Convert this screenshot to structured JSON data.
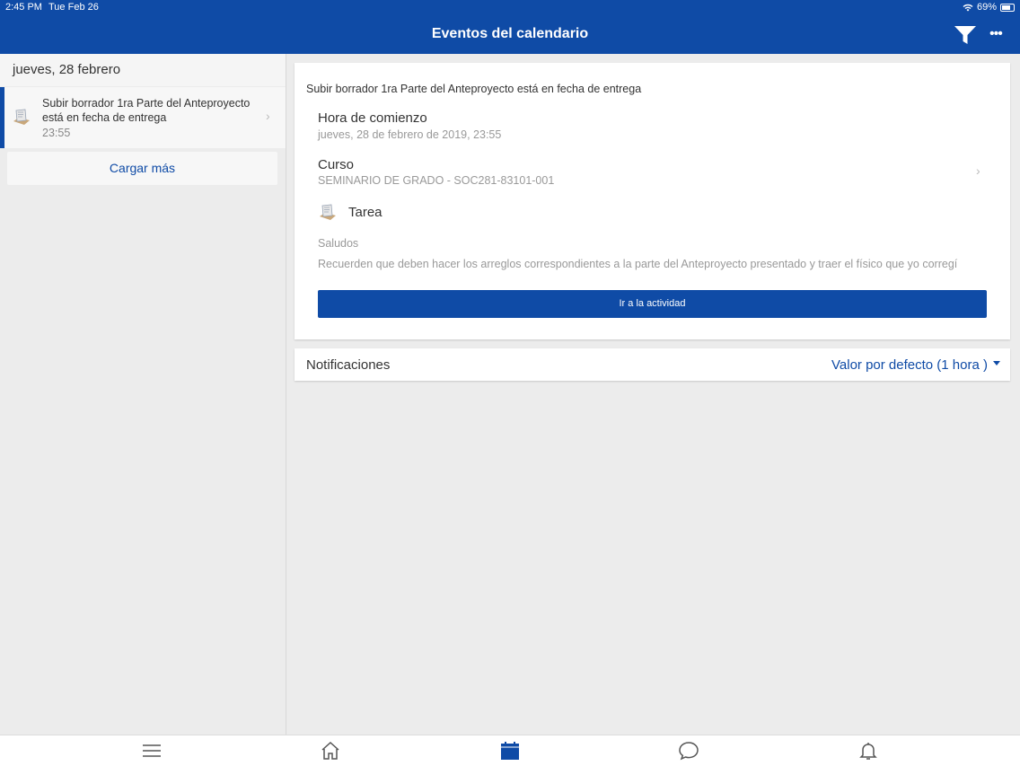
{
  "status": {
    "time": "2:45 PM",
    "date": "Tue Feb 26",
    "battery": "69%"
  },
  "header": {
    "title": "Eventos del calendario",
    "filter_icon": "filter-icon",
    "more_label": "•••"
  },
  "colors": {
    "brand": "#0f4ba6",
    "background": "#ececec"
  },
  "left": {
    "day_header": "jueves, 28 febrero",
    "event": {
      "title": "Subir borrador 1ra Parte del Anteproyecto está en fecha de entrega",
      "time": "23:55",
      "icon": "assignment-icon"
    },
    "load_more": "Cargar más"
  },
  "detail": {
    "title": "Subir borrador 1ra Parte del Anteproyecto está en fecha de entrega",
    "start_label": "Hora de comienzo",
    "start_value": "jueves, 28 de febrero de 2019, 23:55",
    "course_label": "Curso",
    "course_value": "SEMINARIO DE GRADO - SOC281-83101-001",
    "task_label": "Tarea",
    "desc_line1": "Saludos",
    "desc_line2": "Recuerden que deben hacer los arreglos correspondientes a la parte del Anteproyecto presentado y traer el físico que yo corregí",
    "button": "Ir a la actividad"
  },
  "notifications": {
    "label": "Notificaciones",
    "value": "Valor por defecto (1 hora )"
  },
  "tabs": [
    {
      "name": "menu-icon",
      "active": false
    },
    {
      "name": "home-icon",
      "active": false
    },
    {
      "name": "calendar-icon",
      "active": true
    },
    {
      "name": "messages-icon",
      "active": false
    },
    {
      "name": "notifications-icon",
      "active": false
    }
  ]
}
